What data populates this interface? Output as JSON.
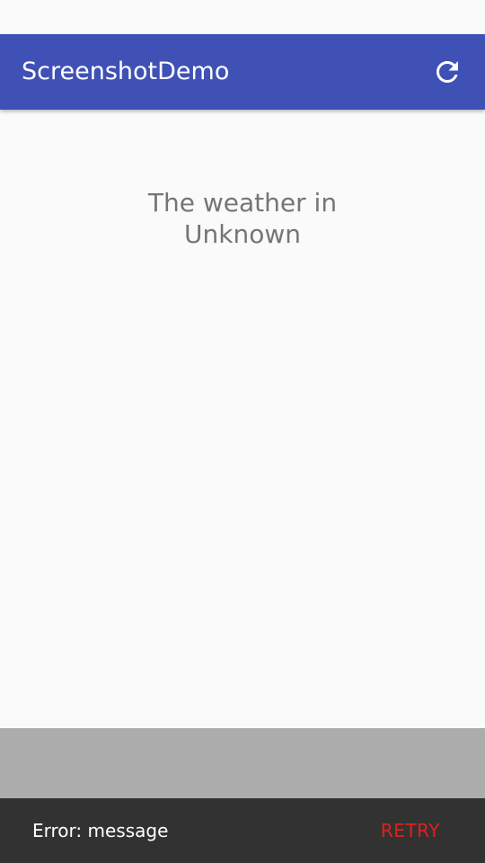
{
  "app_bar": {
    "title": "ScreenshotDemo",
    "action_icon": "refresh-icon",
    "background_color": "#3f51b5"
  },
  "main": {
    "weather_line_1": "The weather in",
    "weather_line_2": "Unknown"
  },
  "snackbar": {
    "message": "Error: message",
    "action_label": "RETRY",
    "action_color": "#e0201d",
    "background_color": "#323232"
  }
}
